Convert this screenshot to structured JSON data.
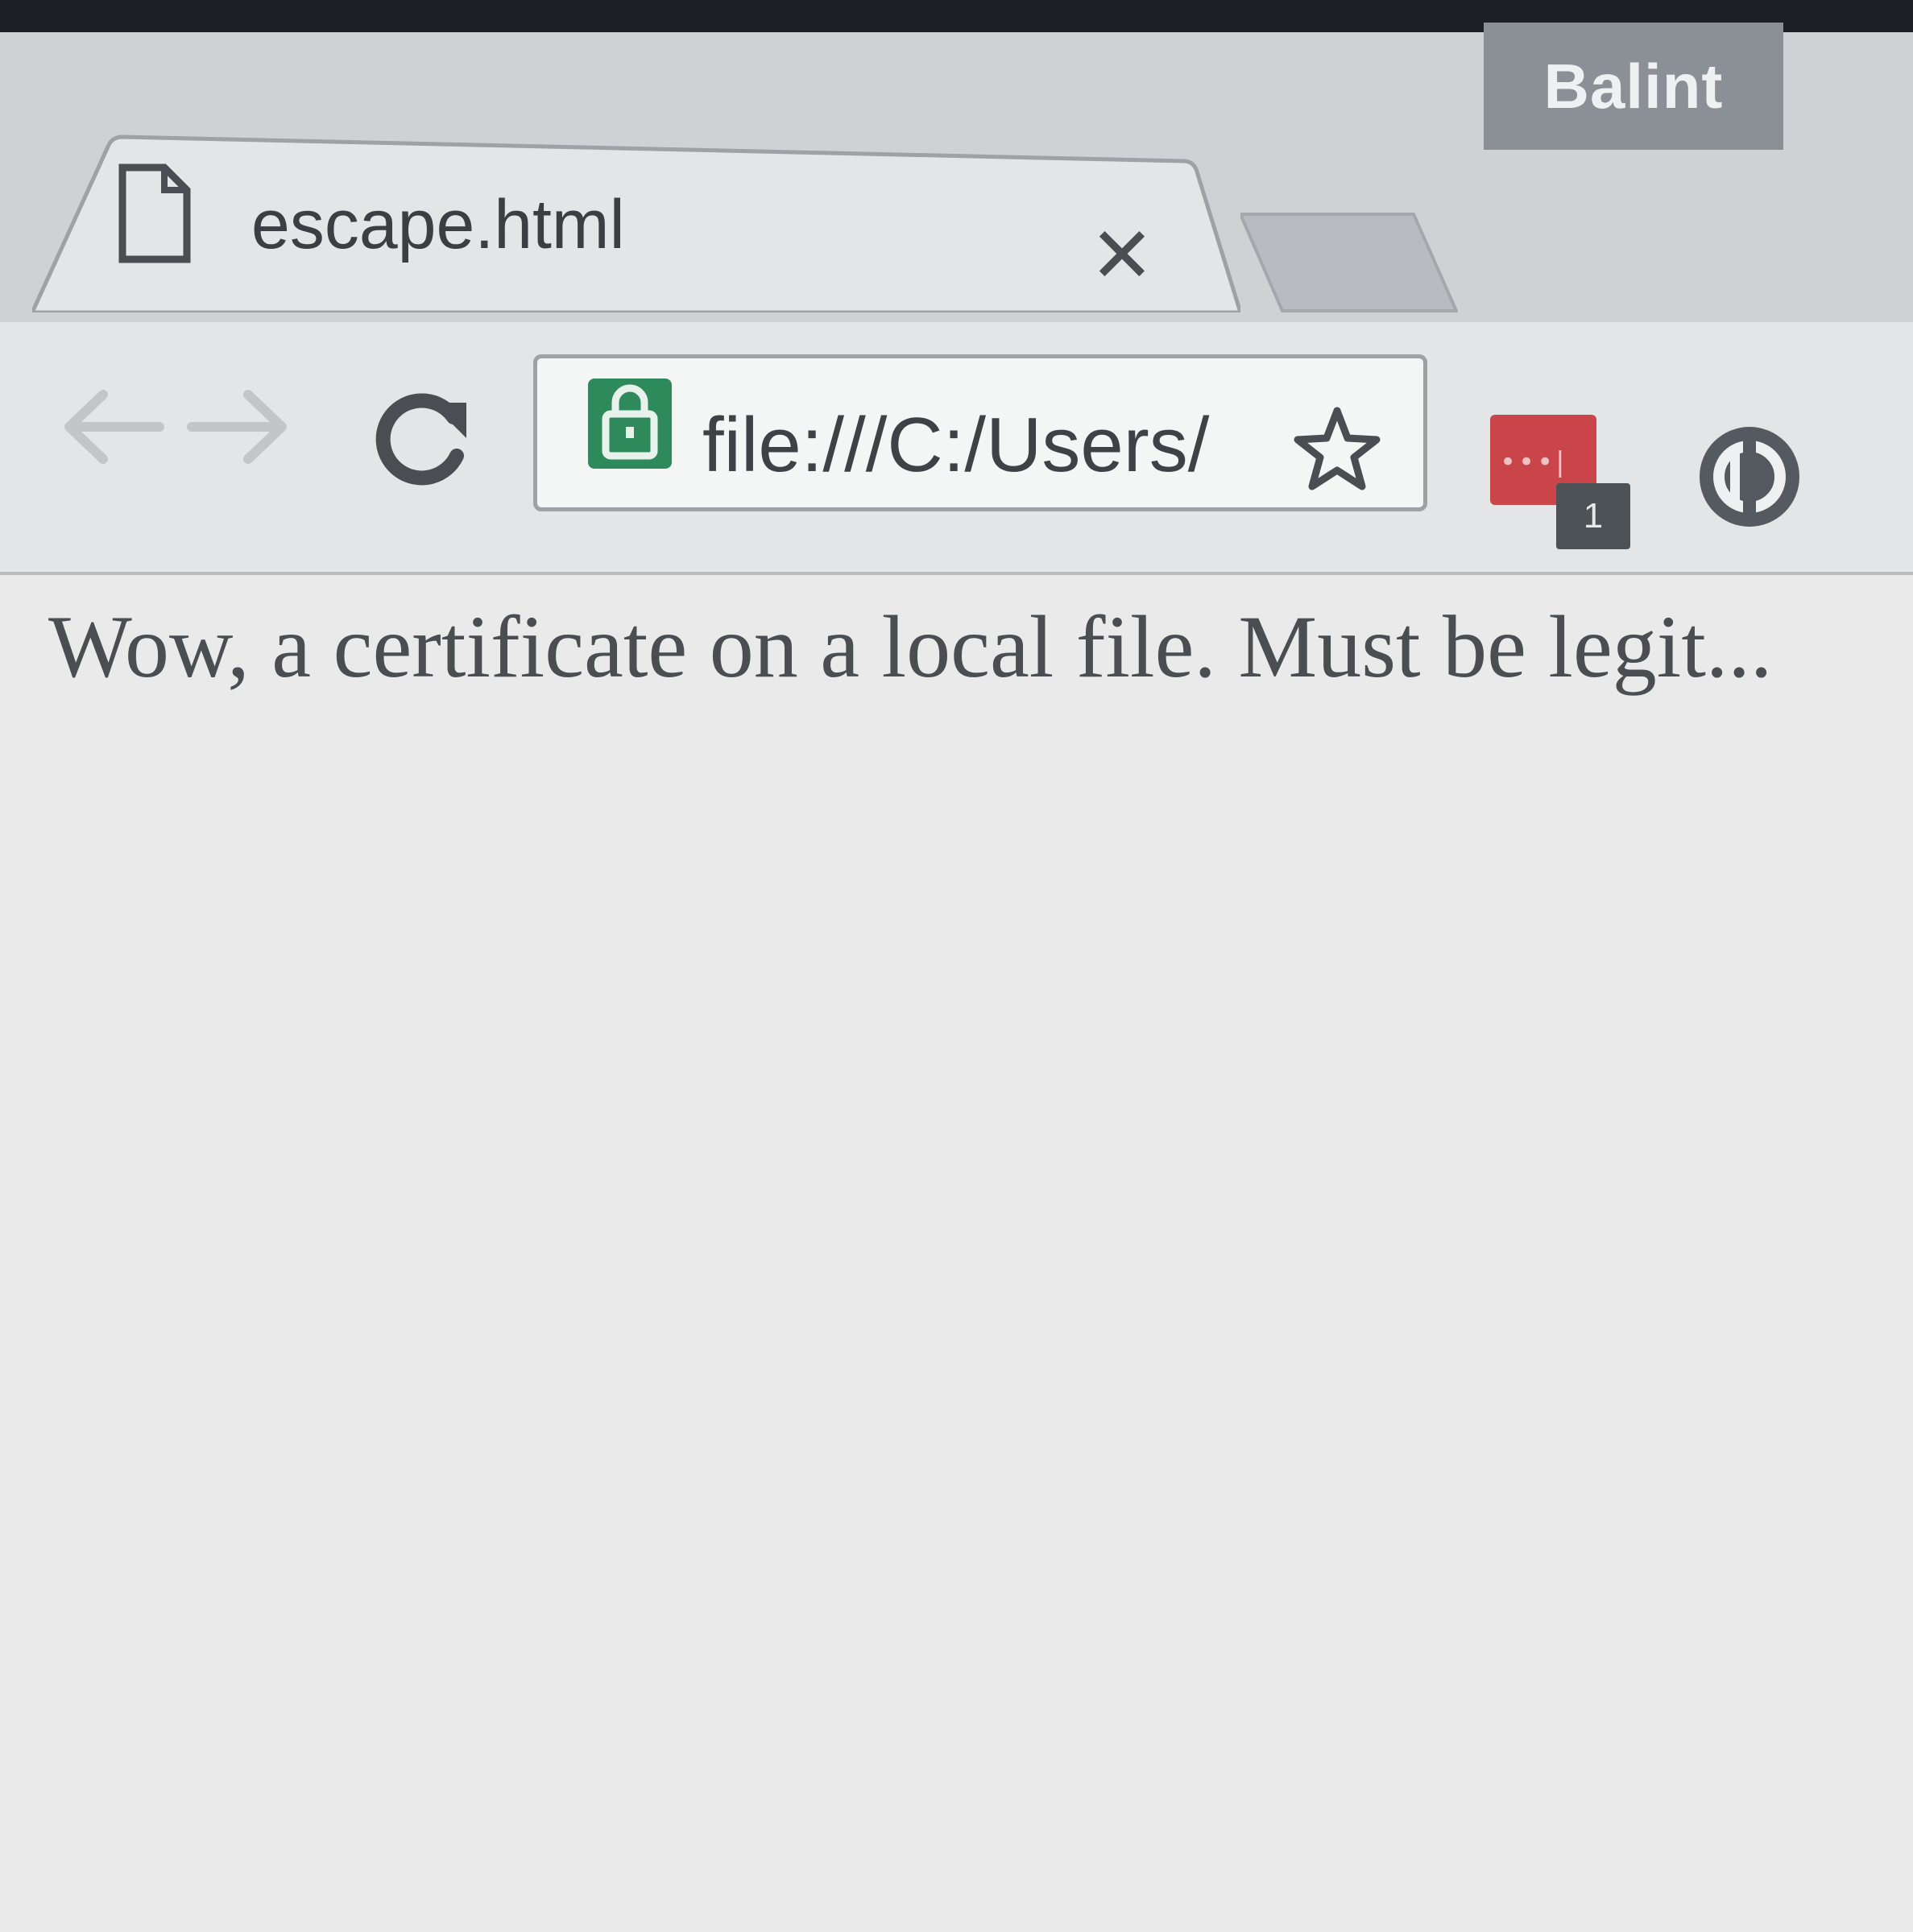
{
  "window": {
    "profile_name": "Balint"
  },
  "tabs": [
    {
      "title": "escape.html",
      "icon": "document-icon",
      "active": true
    }
  ],
  "toolbar": {
    "back_icon": "arrow-left-icon",
    "forward_icon": "arrow-right-icon",
    "reload_icon": "reload-icon",
    "address": "file:///C:/Users/",
    "security_icon": "lock-icon",
    "security_color": "#2f8a5b",
    "bookmark_icon": "star-icon"
  },
  "extensions": [
    {
      "name": "lastpass-extension",
      "color": "#c9454a",
      "badge": "1"
    },
    {
      "name": "circle-extension",
      "icon": "circle-logo-icon"
    }
  ],
  "page": {
    "text": "Wow, a certificate on a local file. Must be legit..."
  }
}
